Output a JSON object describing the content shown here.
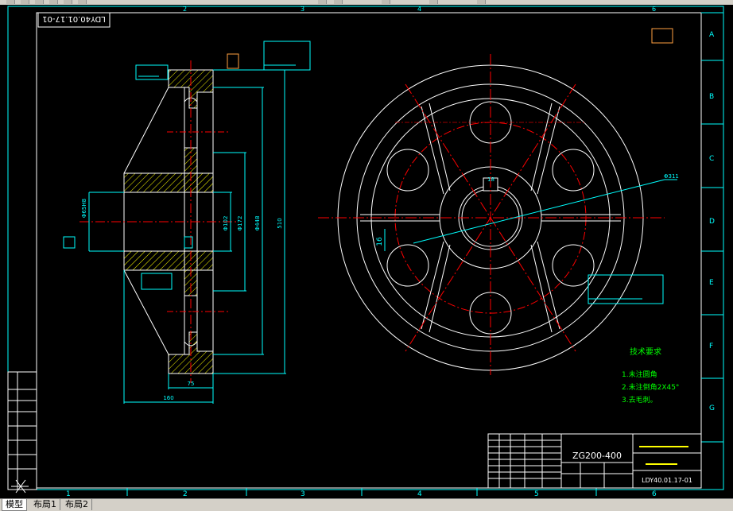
{
  "drawing": {
    "title_flipped": "LDY40.01.17-01",
    "material": "ZG200-400",
    "drawing_number": "LDY40.01.17-01",
    "tech_title": "技术要求",
    "tech_notes": [
      "1.未注圆角",
      "2.未注倒角2X45°",
      "3.去毛刺。"
    ],
    "dims": {
      "bore_dia": "Φ65H8",
      "d102": "Φ102",
      "d172": "Φ172",
      "d448": "Φ448",
      "d510": "510",
      "w75": "75",
      "w160": "160",
      "keyway_w": "18",
      "keyway_h": "16",
      "d311": "Φ311"
    },
    "col_numbers": [
      "1",
      "2",
      "3",
      "4",
      "5",
      "6"
    ],
    "row_letters": [
      "A",
      "B",
      "C",
      "D",
      "E",
      "F",
      "G"
    ]
  },
  "tabs": [
    {
      "label": "模型"
    },
    {
      "label": "布局1"
    },
    {
      "label": "布局2"
    }
  ],
  "colors": {
    "line": "#ffffff",
    "frame": "#00ffff",
    "center": "#ff0000",
    "dim": "#00ffff",
    "hatch": "#ffff00",
    "text_green": "#00ff00"
  }
}
